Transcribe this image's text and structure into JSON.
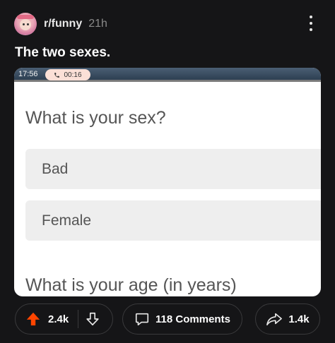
{
  "post": {
    "subreddit": "r/funny",
    "age": "21h",
    "title": "The two sexes.",
    "avatar_icon": "snoo-avatar-icon",
    "menu_icon": "more-vertical-icon"
  },
  "media": {
    "status_time": "17:56",
    "call_duration": "00:16",
    "question_sex": "What is your sex?",
    "options": [
      "Bad",
      "Female"
    ],
    "question_age": "What is your age (in years)"
  },
  "actions": {
    "upvote_count": "2.4k",
    "comments_label": "118 Comments",
    "share_count": "1.4k",
    "upvote_color": "#ff4500"
  }
}
